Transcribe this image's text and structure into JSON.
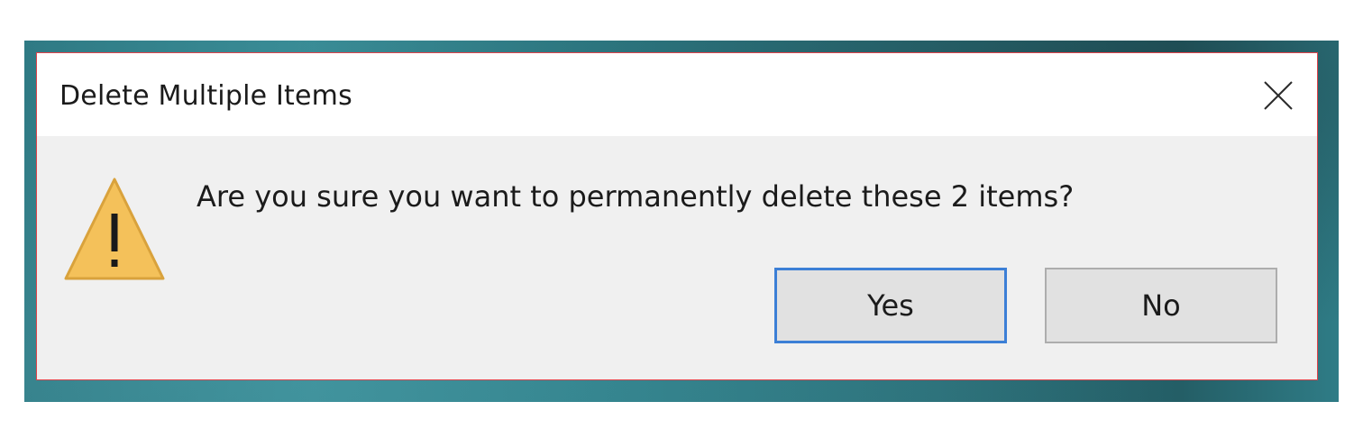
{
  "dialog": {
    "title": "Delete Multiple Items",
    "message": "Are you sure you want to permanently delete these 2 items?",
    "icon": "warning-icon",
    "close_icon": "close-icon",
    "buttons": {
      "yes_label": "Yes",
      "no_label": "No"
    },
    "default_button": "Yes"
  },
  "colors": {
    "dialog_border": "#e0434a",
    "dialog_body": "#f0f0f0",
    "titlebar": "#ffffff",
    "default_button_border": "#3c7fd6",
    "warning_fill": "#f4c15a",
    "desktop_accent": "#2f7a84"
  }
}
